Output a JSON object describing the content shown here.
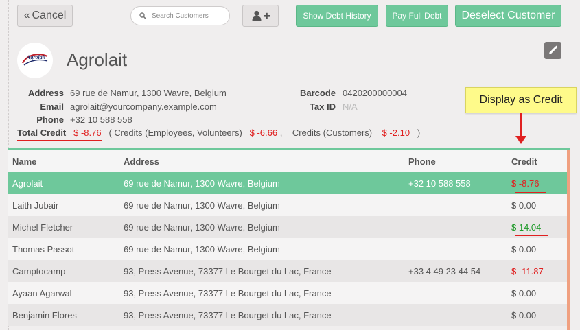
{
  "toolbar": {
    "cancel_label": "Cancel",
    "search_placeholder": "Search Customers",
    "show_debt_history_label": "Show Debt History",
    "pay_full_debt_label": "Pay Full Debt",
    "deselect_customer_label": "Deselect Customer"
  },
  "customer": {
    "name": "Agrolait",
    "logo_text": "Agrolait",
    "address_label": "Address",
    "address": "69 rue de Namur, 1300 Wavre, Belgium",
    "email_label": "Email",
    "email": "agrolait@yourcompany.example.com",
    "phone_label": "Phone",
    "phone": "+32 10 588 558",
    "barcode_label": "Barcode",
    "barcode": "0420200000004",
    "taxid_label": "Tax ID",
    "taxid": "N/A",
    "total_credit_label": "Total Credit",
    "total_credit": "$ -8.76",
    "credits_employees_label": "( Credits (Employees, Volunteers)",
    "credits_employees": "$ -6.66",
    "separator": ",",
    "credits_customers_label": "Credits (Customers)",
    "credits_customers": "$ -2.10",
    "closing_paren": ")"
  },
  "callout": {
    "text": "Display as Credit"
  },
  "table": {
    "headers": {
      "name": "Name",
      "address": "Address",
      "phone": "Phone",
      "credit": "Credit"
    },
    "rows": [
      {
        "name": "Agrolait",
        "address": "69 rue de Namur, 1300 Wavre, Belgium",
        "phone": "+32 10 588 558",
        "credit": "$ -8.76"
      },
      {
        "name": "Laith Jubair",
        "address": "69 rue de Namur, 1300 Wavre, Belgium",
        "phone": "",
        "credit": "$ 0.00"
      },
      {
        "name": "Michel Fletcher",
        "address": "69 rue de Namur, 1300 Wavre, Belgium",
        "phone": "",
        "credit": "$ 14.04"
      },
      {
        "name": "Thomas Passot",
        "address": "69 rue de Namur, 1300 Wavre, Belgium",
        "phone": "",
        "credit": "$ 0.00"
      },
      {
        "name": "Camptocamp",
        "address": "93, Press Avenue, 73377 Le Bourget du Lac, France",
        "phone": "+33 4 49 23 44 54",
        "credit": "$ -11.87"
      },
      {
        "name": "Ayaan Agarwal",
        "address": "93, Press Avenue, 73377 Le Bourget du Lac, France",
        "phone": "",
        "credit": "$ 0.00"
      },
      {
        "name": "Benjamin Flores",
        "address": "93, Press Avenue, 73377 Le Bourget du Lac, France",
        "phone": "",
        "credit": "$ 0.00"
      }
    ]
  },
  "colors": {
    "accent_green": "#6ec89b",
    "credit_negative": "#e02020",
    "credit_positive": "#1f9a2a",
    "callout_bg": "#fefa8a"
  }
}
